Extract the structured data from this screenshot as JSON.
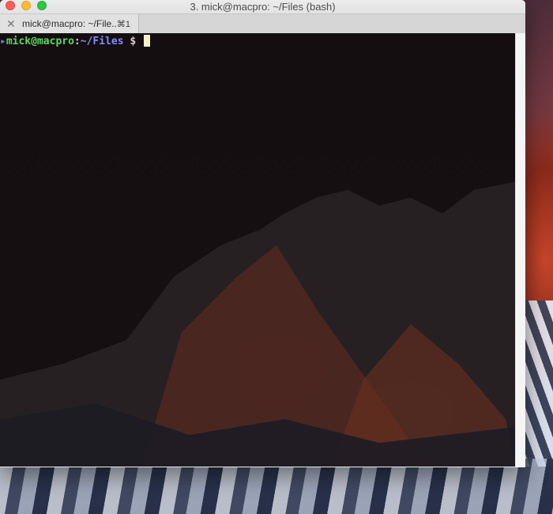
{
  "window": {
    "title": "3. mick@macpro: ~/Files (bash)"
  },
  "tabs": [
    {
      "label": "mick@macpro: ~/File...",
      "shortcut": "⌘1"
    }
  ],
  "terminal": {
    "prompt_user": "mick@macpro",
    "prompt_sep": ":",
    "prompt_path": "~/Files",
    "prompt_symbol": " $ "
  },
  "icons": {
    "tab_close": "close-icon",
    "prompt_marker": "triangle-right-icon"
  },
  "colors": {
    "user": "#5fd75f",
    "path": "#8787ff",
    "cursor": "#f8f1c8",
    "close": "#fc5f57",
    "minimize": "#fdbc2e",
    "zoom": "#29c940"
  }
}
